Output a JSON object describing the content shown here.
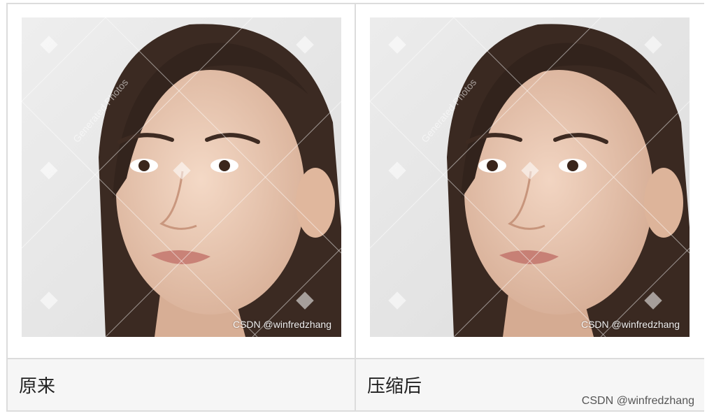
{
  "captions": {
    "original": "原来",
    "compressed": "压缩后"
  },
  "photos": {
    "image_watermark": "CSDN @winfredzhang",
    "stock_watermark": "Generated Photos"
  },
  "footer": {
    "watermark": "CSDN @winfredzhang"
  }
}
